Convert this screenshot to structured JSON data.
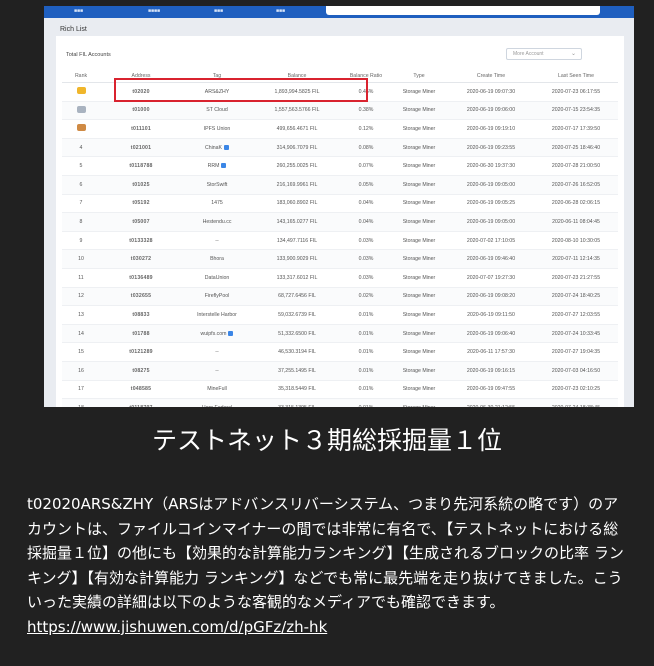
{
  "screenshot": {
    "page_title": "Rich List",
    "total_label": "Total FIL Accounts",
    "dropdown_label": "More Account",
    "columns": [
      "Rank",
      "Address",
      "Tag",
      "Balance",
      "Balance Ratio",
      "Type",
      "Create Time",
      "Last Seen Time"
    ],
    "rows": [
      {
        "rank": "",
        "medal": "gold",
        "address": "t02020",
        "tag": "ARS&ZHY",
        "verified": false,
        "balance": "1,893,994.5825 FIL",
        "ratio": "0.46%",
        "type": "Storage Miner",
        "create": "2020-06-19 09:07:30",
        "last": "2020-07-23 06:17:55"
      },
      {
        "rank": "",
        "medal": "silver",
        "address": "t01000",
        "tag": "ST Cloud",
        "verified": false,
        "balance": "1,557,563.5766 FIL",
        "ratio": "0.38%",
        "type": "Storage Miner",
        "create": "2020-06-19 09:06:00",
        "last": "2020-07-15 23:54:35"
      },
      {
        "rank": "",
        "medal": "bronze",
        "address": "t011101",
        "tag": "IPFS Union",
        "verified": false,
        "balance": "499,656.4671 FIL",
        "ratio": "0.12%",
        "type": "Storage Miner",
        "create": "2020-06-19 09:19:10",
        "last": "2020-07-17 17:39:50"
      },
      {
        "rank": "4",
        "medal": "",
        "address": "t021001",
        "tag": "ChinaK",
        "verified": true,
        "balance": "314,906.7079 FIL",
        "ratio": "0.08%",
        "type": "Storage Miner",
        "create": "2020-06-19 09:23:55",
        "last": "2020-07-25 18:46:40"
      },
      {
        "rank": "5",
        "medal": "",
        "address": "t0118788",
        "tag": "RRM",
        "verified": true,
        "balance": "260,255.0025 FIL",
        "ratio": "0.07%",
        "type": "Storage Miner",
        "create": "2020-06-30 19:37:30",
        "last": "2020-07-28 21:00:50"
      },
      {
        "rank": "6",
        "medal": "",
        "address": "t01025",
        "tag": "StorSwift",
        "verified": false,
        "balance": "216,169.9961 FIL",
        "ratio": "0.05%",
        "type": "Storage Miner",
        "create": "2020-06-19 09:05:00",
        "last": "2020-07-26 16:52:05"
      },
      {
        "rank": "7",
        "medal": "",
        "address": "t05192",
        "tag": "1475",
        "verified": false,
        "balance": "183,060.8902 FIL",
        "ratio": "0.04%",
        "type": "Storage Miner",
        "create": "2020-06-19 09:05:25",
        "last": "2020-06-28 02:06:15"
      },
      {
        "rank": "8",
        "medal": "",
        "address": "t05007",
        "tag": "Hestendu.cc",
        "verified": false,
        "balance": "143,165.0277 FIL",
        "ratio": "0.04%",
        "type": "Storage Miner",
        "create": "2020-06-19 09:05:00",
        "last": "2020-06-11 08:04:45"
      },
      {
        "rank": "9",
        "medal": "",
        "address": "t0133328",
        "tag": "--",
        "verified": false,
        "balance": "134,497.7116 FIL",
        "ratio": "0.03%",
        "type": "Storage Miner",
        "create": "2020-07-02 17:10:05",
        "last": "2020-08-10 10:30:05"
      },
      {
        "rank": "10",
        "medal": "",
        "address": "t030272",
        "tag": "Bhora",
        "verified": false,
        "balance": "133,900.9029 FIL",
        "ratio": "0.03%",
        "type": "Storage Miner",
        "create": "2020-06-19 09:46:40",
        "last": "2020-07-11 12:14:35"
      },
      {
        "rank": "11",
        "medal": "",
        "address": "t0136489",
        "tag": "DataUnion",
        "verified": false,
        "balance": "133,317.6012 FIL",
        "ratio": "0.03%",
        "type": "Storage Miner",
        "create": "2020-07-07 19:27:30",
        "last": "2020-07-23 21:27:55"
      },
      {
        "rank": "12",
        "medal": "",
        "address": "t032655",
        "tag": "FireflyPool",
        "verified": false,
        "balance": "68,727.6456 FIL",
        "ratio": "0.02%",
        "type": "Storage Miner",
        "create": "2020-06-19 09:08:20",
        "last": "2020-07-24 18:40:25"
      },
      {
        "rank": "13",
        "medal": "",
        "address": "t08833",
        "tag": "Interstelle Harbor",
        "verified": false,
        "balance": "59,032.6739 FIL",
        "ratio": "0.01%",
        "type": "Storage Miner",
        "create": "2020-06-19 09:11:50",
        "last": "2020-07-27 12:03:55"
      },
      {
        "rank": "14",
        "medal": "",
        "address": "t01788",
        "tag": "wuipfs.com",
        "verified": true,
        "balance": "51,332.6500 FIL",
        "ratio": "0.01%",
        "type": "Storage Miner",
        "create": "2020-06-19 09:06:40",
        "last": "2020-07-24 10:33:45"
      },
      {
        "rank": "15",
        "medal": "",
        "address": "t0121289",
        "tag": "--",
        "verified": false,
        "balance": "46,530.3194 FIL",
        "ratio": "0.01%",
        "type": "Storage Miner",
        "create": "2020-06-11 17:57:30",
        "last": "2020-07-27 19:04:35"
      },
      {
        "rank": "16",
        "medal": "",
        "address": "t08275",
        "tag": "--",
        "verified": false,
        "balance": "37,255.1495 FIL",
        "ratio": "0.01%",
        "type": "Storage Miner",
        "create": "2020-06-19 09:16:15",
        "last": "2020-07-03 04:16:50"
      },
      {
        "rank": "17",
        "medal": "",
        "address": "t048585",
        "tag": "MineFull",
        "verified": false,
        "balance": "35,318.5449 FIL",
        "ratio": "0.01%",
        "type": "Storage Miner",
        "create": "2020-06-19 09:47:55",
        "last": "2020-07-23 02:10:25"
      },
      {
        "rank": "18",
        "medal": "",
        "address": "t0118797",
        "tag": "Horn Federal",
        "verified": false,
        "balance": "33,315.1395 FIL",
        "ratio": "0.01%",
        "type": "Storage Miner",
        "create": "2020-06-30 21:12:55",
        "last": "2020-07-24 18:38:45"
      },
      {
        "rank": "19",
        "medal": "",
        "address": "t049469",
        "tag": "Particle Vision",
        "verified": false,
        "balance": "32,825.7297 FIL",
        "ratio": "0.01%",
        "type": "Storage Miner",
        "create": "2020-06-19 10:19:35",
        "last": "2020-08-13 22:58:20"
      },
      {
        "rank": "20",
        "medal": "",
        "address": "t09964",
        "tag": "--",
        "verified": false,
        "balance": "29,569.3938 FIL",
        "ratio": "0.01%",
        "type": "Storage Miner",
        "create": "2020-06-19 09:17:05",
        "last": "2020-07-21 19:35:25"
      }
    ]
  },
  "caption": {
    "heading": "テストネット３期総採掘量１位",
    "body": "t02020ARS&ZHY（ARSはアドバンスリバーシステム、つまり先河系統の略です）のアカウントは、ファイルコインマイナーの間では非常に有名で、【テストネットにおける総採掘量１位】の他にも【効果的な計算能力ランキング】【生成されるブロックの比率 ランキング】【有効な計算能力 ランキング】などでも常に最先端を走り抜けてきました。こういった実績の詳細は以下のような客観的なメディアでも確認できます。",
    "link": "https://www.jishuwen.com/d/pGFz/zh-hk"
  },
  "colors": {
    "background": "#212121",
    "highlight": "#d9232f",
    "topbar": "#1f5fbf"
  }
}
